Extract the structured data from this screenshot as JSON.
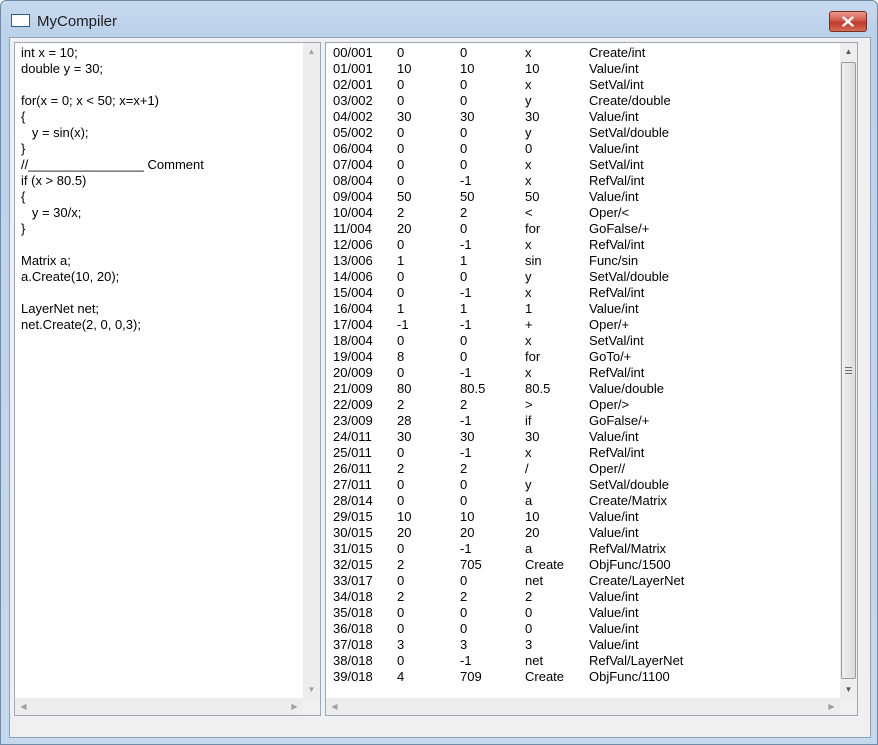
{
  "window": {
    "title": "MyCompiler"
  },
  "source_lines": [
    "int x = 10;",
    "double y = 30;",
    "",
    "for(x = 0; x < 50; x=x+1)",
    "{",
    "   y = sin(x);",
    "}",
    "//________________ Comment",
    "if (x > 80.5)",
    "{",
    "   y = 30/x;",
    "}",
    "",
    "Matrix a;",
    "a.Create(10, 20);",
    "",
    "LayerNet net;",
    "net.Create(2, 0, 0,3);"
  ],
  "instructions": [
    [
      "00/001",
      "0",
      "0",
      "x",
      "Create/int"
    ],
    [
      "01/001",
      "10",
      "10",
      "10",
      "Value/int"
    ],
    [
      "02/001",
      "0",
      "0",
      "x",
      "SetVal/int"
    ],
    [
      "03/002",
      "0",
      "0",
      "y",
      "Create/double"
    ],
    [
      "04/002",
      "30",
      "30",
      "30",
      "Value/int"
    ],
    [
      "05/002",
      "0",
      "0",
      "y",
      "SetVal/double"
    ],
    [
      "06/004",
      "0",
      "0",
      "0",
      "Value/int"
    ],
    [
      "07/004",
      "0",
      "0",
      "x",
      "SetVal/int"
    ],
    [
      "08/004",
      "0",
      "-1",
      "x",
      "RefVal/int"
    ],
    [
      "09/004",
      "50",
      "50",
      "50",
      "Value/int"
    ],
    [
      "10/004",
      "2",
      "2",
      "<",
      "Oper/<"
    ],
    [
      "11/004",
      "20",
      "0",
      "for",
      "GoFalse/+"
    ],
    [
      "12/006",
      "0",
      "-1",
      "x",
      "RefVal/int"
    ],
    [
      "13/006",
      "1",
      "1",
      "sin",
      "Func/sin"
    ],
    [
      "14/006",
      "0",
      "0",
      "y",
      "SetVal/double"
    ],
    [
      "15/004",
      "0",
      "-1",
      "x",
      "RefVal/int"
    ],
    [
      "16/004",
      "1",
      "1",
      "1",
      "Value/int"
    ],
    [
      "17/004",
      "-1",
      "-1",
      "+",
      "Oper/+"
    ],
    [
      "18/004",
      "0",
      "0",
      "x",
      "SetVal/int"
    ],
    [
      "19/004",
      "8",
      "0",
      "for",
      "GoTo/+"
    ],
    [
      "20/009",
      "0",
      "-1",
      "x",
      "RefVal/int"
    ],
    [
      "21/009",
      "80",
      "80.5",
      "80.5",
      "Value/double"
    ],
    [
      "22/009",
      "2",
      "2",
      ">",
      "Oper/>"
    ],
    [
      "23/009",
      "28",
      "-1",
      "if",
      "GoFalse/+"
    ],
    [
      "24/011",
      "30",
      "30",
      "30",
      "Value/int"
    ],
    [
      "25/011",
      "0",
      "-1",
      "x",
      "RefVal/int"
    ],
    [
      "26/011",
      "2",
      "2",
      "/",
      "Oper//"
    ],
    [
      "27/011",
      "0",
      "0",
      "y",
      "SetVal/double"
    ],
    [
      "28/014",
      "0",
      "0",
      "a",
      "Create/Matrix"
    ],
    [
      "29/015",
      "10",
      "10",
      "10",
      "Value/int"
    ],
    [
      "30/015",
      "20",
      "20",
      "20",
      "Value/int"
    ],
    [
      "31/015",
      "0",
      "-1",
      "a",
      "RefVal/Matrix"
    ],
    [
      "32/015",
      "2",
      "705",
      "Create",
      "ObjFunc/1500"
    ],
    [
      "33/017",
      "0",
      "0",
      "net",
      "Create/LayerNet"
    ],
    [
      "34/018",
      "2",
      "2",
      "2",
      "Value/int"
    ],
    [
      "35/018",
      "0",
      "0",
      "0",
      "Value/int"
    ],
    [
      "36/018",
      "0",
      "0",
      "0",
      "Value/int"
    ],
    [
      "37/018",
      "3",
      "3",
      "3",
      "Value/int"
    ],
    [
      "38/018",
      "0",
      "-1",
      "net",
      "RefVal/LayerNet"
    ],
    [
      "39/018",
      "4",
      "709",
      "Create",
      "ObjFunc/1100"
    ]
  ],
  "icons": {
    "app": "window-icon",
    "close": "close-icon",
    "scroll_up": "arrow-up-icon",
    "scroll_down": "arrow-down-icon",
    "scroll_left": "arrow-left-icon",
    "scroll_right": "arrow-right-icon"
  },
  "colors": {
    "close_button": "#c94a3a",
    "title_bar": "#bcd1ea"
  }
}
